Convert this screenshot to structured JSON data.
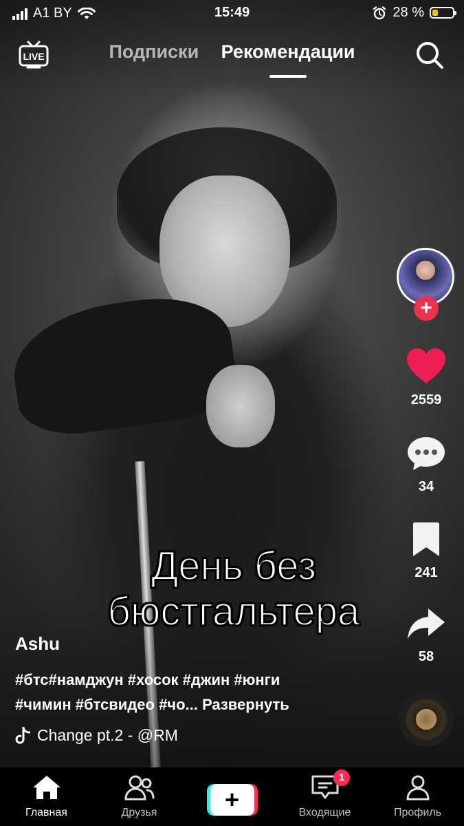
{
  "status_bar": {
    "carrier": "A1 BY",
    "time": "15:49",
    "battery_percent": "28 %",
    "battery_level": 0.28
  },
  "header": {
    "live_label": "LIVE",
    "tabs": [
      {
        "label": "Подписки",
        "active": false
      },
      {
        "label": "Рекомендации",
        "active": true
      }
    ]
  },
  "video": {
    "caption_line1": "День без",
    "caption_line2": "бюстгальтера"
  },
  "actions": {
    "likes": "2559",
    "comments": "34",
    "saves": "241",
    "shares": "58"
  },
  "post": {
    "username": "Ashu",
    "hashtags_line1": "#бтс#намджун #хосок #джин #юнги",
    "hashtags_line2": "#чимин #бтсвидео #чо...",
    "expand_label": "Развернуть",
    "sound": "Change pt.2 - @RM"
  },
  "nav": {
    "home": "Главная",
    "friends": "Друзья",
    "create": "+",
    "inbox": "Входящие",
    "inbox_badge": "1",
    "profile": "Профиль"
  },
  "colors": {
    "like": "#ee1d52",
    "follow": "#f0304e",
    "battery": "#f5c400",
    "create_left": "#25f4ee",
    "create_right": "#fe2c55"
  }
}
